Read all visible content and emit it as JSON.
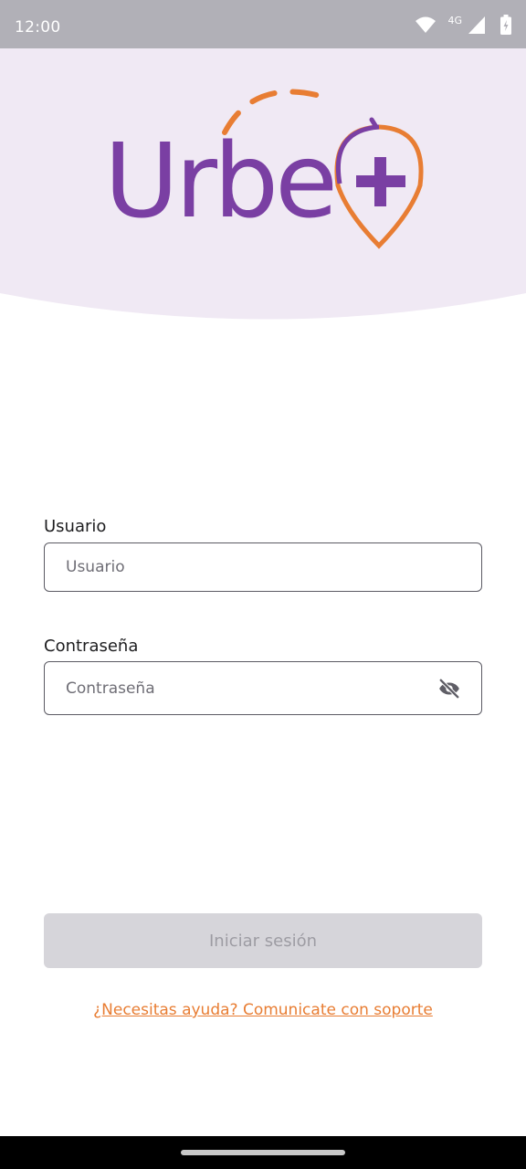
{
  "status_bar": {
    "time": "12:00",
    "network": "4G",
    "icons": [
      "wifi-icon",
      "signal-icon",
      "battery-icon"
    ]
  },
  "logo": {
    "text": "Urbe",
    "colors": {
      "purple": "#7a3fa3",
      "orange": "#e87d33"
    }
  },
  "form": {
    "username": {
      "label": "Usuario",
      "placeholder": "Usuario",
      "value": ""
    },
    "password": {
      "label": "Contraseña",
      "placeholder": "Contraseña",
      "value": "",
      "toggle_icon": "eye-off-icon"
    },
    "submit_label": "Iniciar sesión",
    "support_link": "¿Necesitas ayuda? Comunicate con soporte"
  },
  "colors": {
    "accent": "#e87d33",
    "brand": "#7a3fa3",
    "header_bg": "#f0e9f4",
    "button_disabled_bg": "#d6d5da",
    "button_disabled_text": "#9d9ca3"
  }
}
